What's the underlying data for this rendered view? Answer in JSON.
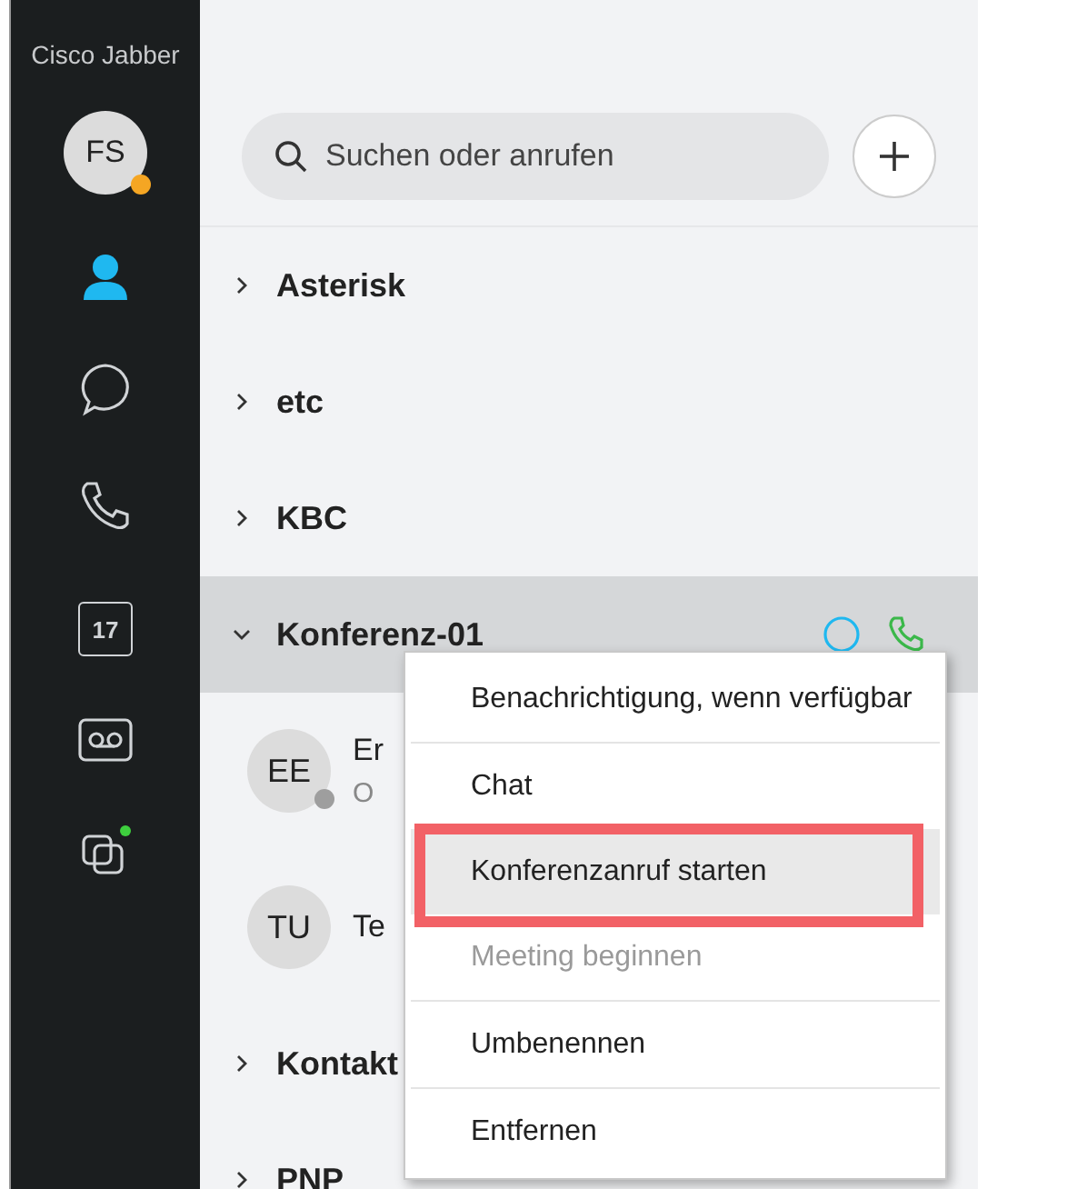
{
  "app_title": "Cisco Jabber",
  "profile": {
    "initials": "FS",
    "color": "#f5a623"
  },
  "nav": [
    {
      "kind": "contacts",
      "selected": true
    },
    {
      "kind": "chat",
      "selected": false
    },
    {
      "kind": "calls",
      "selected": false
    },
    {
      "kind": "calendar",
      "label": "17",
      "selected": false
    },
    {
      "kind": "voicemail",
      "selected": false
    },
    {
      "kind": "meetings",
      "selected": false,
      "badge": true
    }
  ],
  "search": {
    "placeholder": "Suchen oder anrufen"
  },
  "groups": [
    {
      "name": "Asterisk",
      "expanded": false,
      "selected": false
    },
    {
      "name": "etc",
      "expanded": false,
      "selected": false
    },
    {
      "name": "KBC",
      "expanded": false,
      "selected": false
    },
    {
      "name": "Konferenz-01",
      "expanded": true,
      "selected": true,
      "children": [
        {
          "initials": "EE",
          "name": "Er",
          "subtitle": "O",
          "color": "#9e9e9e"
        },
        {
          "initials": "TU",
          "name": "Te"
        }
      ]
    },
    {
      "name": "Kontakt",
      "expanded": false,
      "selected": false
    },
    {
      "name": "PNP",
      "expanded": false,
      "selected": false
    }
  ],
  "context_menu": [
    {
      "label": "Benachrichtigung, wenn verfügbar",
      "disabled": false,
      "selected": false
    },
    {
      "label": "Chat",
      "disabled": false,
      "selected": false
    },
    {
      "label": "Konferenzanruf starten",
      "disabled": false,
      "selected": true,
      "annotated": true
    },
    {
      "label": "Meeting beginnen",
      "disabled": true,
      "selected": false
    },
    {
      "label": "Umbenennen",
      "disabled": false,
      "selected": false
    },
    {
      "label": "Entfernen",
      "disabled": false,
      "selected": false
    }
  ]
}
